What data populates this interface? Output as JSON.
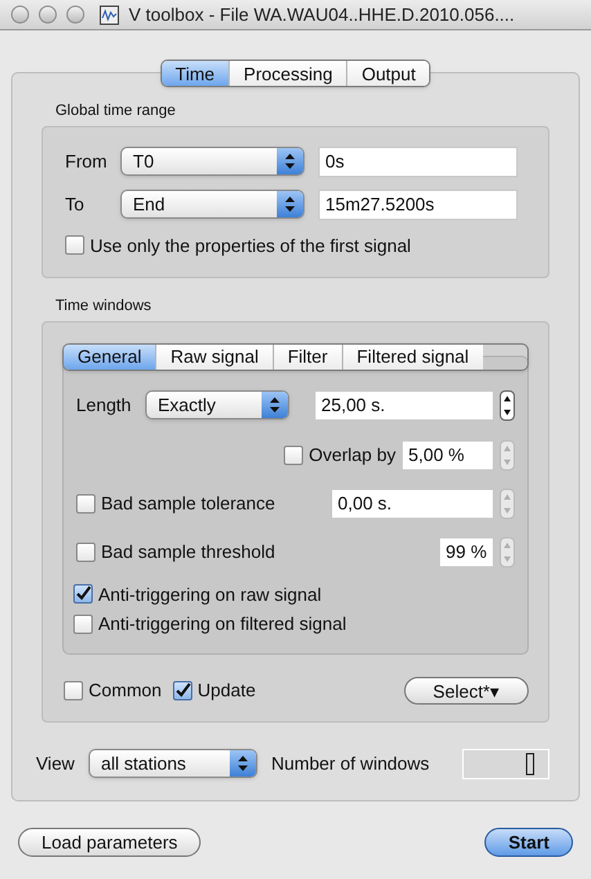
{
  "window": {
    "title": "V toolbox - File WA.WAU04..HHE.D.2010.056...."
  },
  "main_tabs": [
    {
      "label": "Time",
      "selected": true
    },
    {
      "label": "Processing",
      "selected": false
    },
    {
      "label": "Output",
      "selected": false
    }
  ],
  "global_time_range": {
    "title": "Global time range",
    "rows": [
      {
        "label": "From",
        "selection": "T0",
        "value": "0s"
      },
      {
        "label": "To",
        "selection": "End",
        "value": "15m27.5200s"
      }
    ],
    "first_signal": {
      "label": "Use only the properties of the first signal",
      "checked": false
    }
  },
  "time_windows": {
    "title": "Time windows",
    "tabs": [
      {
        "label": "General",
        "selected": true
      },
      {
        "label": "Raw signal",
        "selected": false
      },
      {
        "label": "Filter",
        "selected": false
      },
      {
        "label": "Filtered signal",
        "selected": false
      }
    ],
    "length": {
      "label": "Length",
      "selection": "Exactly",
      "value": "25,00 s.",
      "stepper_disabled": false
    },
    "overlap": {
      "label": "Overlap by",
      "checked": false,
      "value": "5,00 %",
      "stepper_disabled": true
    },
    "bad_sample_tolerance": {
      "label": "Bad sample tolerance",
      "checked": false,
      "value": "0,00 s.",
      "stepper_disabled": true
    },
    "bad_sample_threshold": {
      "label": "Bad sample threshold",
      "checked": false,
      "value": "99 %",
      "stepper_disabled": true
    },
    "anti_triggering": [
      {
        "label": "Anti-triggering on raw signal",
        "checked": true
      },
      {
        "label": "Anti-triggering on filtered signal",
        "checked": false
      }
    ],
    "common": {
      "label": "Common",
      "checked": false
    },
    "update": {
      "label": "Update",
      "checked": true
    },
    "select_button": "Select*▾"
  },
  "view": {
    "label": "View",
    "selection": "all stations"
  },
  "number_of_windows": {
    "label": "Number of windows"
  },
  "buttons": [
    {
      "label": "Load parameters",
      "kind": "normal"
    },
    {
      "label": "Start",
      "kind": "default"
    }
  ]
}
